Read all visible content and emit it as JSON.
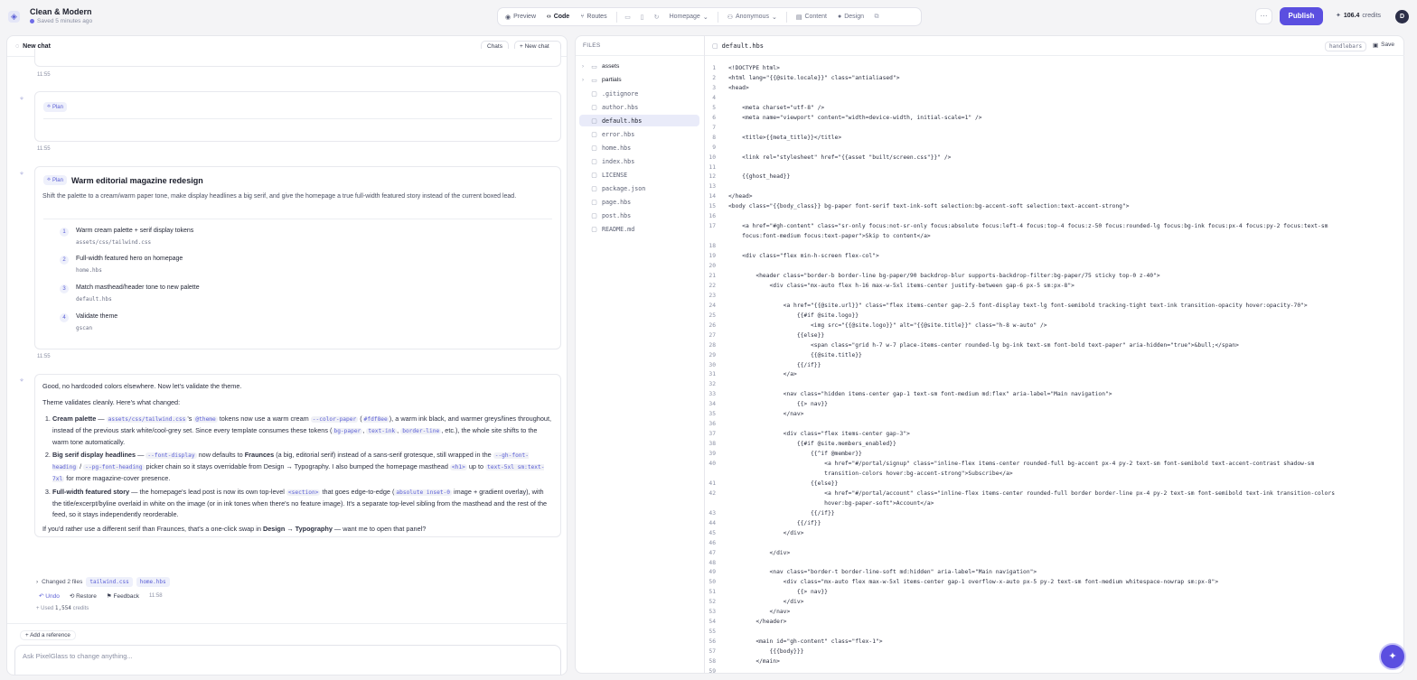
{
  "app": {
    "title": "Clean & Modern",
    "saved": "Saved 5 minutes ago"
  },
  "toolbar": {
    "modes": [
      "Preview",
      "Code",
      "Routes"
    ],
    "active_mode": "Code",
    "page_select": "Homepage",
    "role_select": "Anonymous",
    "content_label": "Content",
    "design_label": "Design",
    "publish": "Publish",
    "credits_value": "106.4",
    "credits_label": "credits",
    "avatar": "D"
  },
  "chat": {
    "title": "New chat",
    "chats_btn": "Chats",
    "new_chat_btn": "New chat",
    "times": [
      "11:55",
      "11:55",
      "11:55",
      "11:58"
    ],
    "plan_badge": "Plan",
    "plan": {
      "title": "Warm editorial magazine redesign",
      "desc": "Shift the palette to a cream/warm paper tone, make display headlines a big serif, and give the homepage a true full-width featured story instead of the current boxed lead.",
      "steps": [
        {
          "n": "1",
          "label": "Warm cream palette + serif display tokens",
          "file": "assets/css/tailwind.css"
        },
        {
          "n": "2",
          "label": "Full-width featured hero on homepage",
          "file": "home.hbs"
        },
        {
          "n": "3",
          "label": "Match masthead/header tone to new palette",
          "file": "default.hbs"
        },
        {
          "n": "4",
          "label": "Validate theme",
          "file": "gscan"
        }
      ]
    },
    "msg": {
      "p1": "Good, no hardcoded colors elsewhere. Now let's validate the theme.",
      "p2": "Theme validates cleanly. Here's what changed:",
      "i1": {
        "b": "Cream palette",
        "t1": " — ",
        "c1": "assets/css/tailwind.css",
        "t2": "'s ",
        "c2": "@theme",
        "t3": " tokens now use a warm cream ",
        "c3": "--color-paper",
        "t4": " (",
        "c4": "#fdf8ee",
        "t5": "), a warm ink black, and warmer greys/lines throughout, instead of the previous stark white/cool-grey set. Since every template consumes these tokens (",
        "c5": "bg-paper",
        "t6": ", ",
        "c6": "text-ink",
        "t7": ", ",
        "c7": "border-line",
        "t8": ", etc.), the whole site shifts to the warm tone automatically."
      },
      "i2": {
        "b": "Big serif display headlines",
        "t1": " — ",
        "c1": "--font-display",
        "t2": " now defaults to ",
        "b2": "Fraunces",
        "t3": " (a big, editorial serif) instead of a sans-serif grotesque, still wrapped in the ",
        "c2": "--gh-font-heading",
        "t4": " / ",
        "c3": "--pg-font-heading",
        "t5": " picker chain so it stays overridable from Design → Typography. I also bumped the homepage masthead ",
        "c4": "<h1>",
        "t6": " up to ",
        "c5": "text-5xl sm:text-7xl",
        "t7": " for more magazine-cover presence."
      },
      "i3": {
        "b": "Full-width featured story",
        "t1": " — the homepage's lead post is now its own top-level ",
        "c1": "<section>",
        "t2": " that goes edge-to-edge (",
        "c2": "absolute inset-0",
        "t3": " image + gradient overlay), with the title/excerpt/byline overlaid in white on the image (or in ink tones when there's no feature image). It's a separate top-level sibling from the masthead and the rest of the feed, so it stays independently reorderable."
      },
      "p3a": "If you'd rather use a different serif than Fraunces, that's a one-click swap in ",
      "p3b": "Design → Typography",
      "p3c": " — want me to open that panel?"
    },
    "changed": "Changed 2 files",
    "changed_files": [
      "tailwind.css",
      "home.hbs"
    ],
    "actions": {
      "undo": "Undo",
      "restore": "Restore",
      "feedback": "Feedback"
    },
    "used": "Used",
    "used_value": "1,554",
    "used_unit": "credits",
    "add_ref": "Add a reference",
    "composer_placeholder": "Ask PixelGlass to change anything..."
  },
  "files": {
    "header": "FILES",
    "items": [
      {
        "name": "assets",
        "type": "folder"
      },
      {
        "name": "partials",
        "type": "folder"
      },
      {
        "name": ".gitignore",
        "type": "file"
      },
      {
        "name": "author.hbs",
        "type": "file"
      },
      {
        "name": "default.hbs",
        "type": "file",
        "selected": true
      },
      {
        "name": "error.hbs",
        "type": "file"
      },
      {
        "name": "home.hbs",
        "type": "file"
      },
      {
        "name": "index.hbs",
        "type": "file"
      },
      {
        "name": "LICENSE",
        "type": "file"
      },
      {
        "name": "package.json",
        "type": "file"
      },
      {
        "name": "page.hbs",
        "type": "file"
      },
      {
        "name": "post.hbs",
        "type": "file"
      },
      {
        "name": "README.md",
        "type": "file"
      }
    ]
  },
  "editor": {
    "filename": "default.hbs",
    "lang": "handlebars",
    "save": "Save",
    "lines": [
      {
        "n": "1",
        "c": "<!DOCTYPE html>"
      },
      {
        "n": "2",
        "c": "<html lang=\"{{@site.locale}}\" class=\"antialiased\">"
      },
      {
        "n": "3",
        "c": "<head>"
      },
      {
        "n": "4",
        "c": ""
      },
      {
        "n": "5",
        "c": "    <meta charset=\"utf-8\" />"
      },
      {
        "n": "6",
        "c": "    <meta name=\"viewport\" content=\"width=device-width, initial-scale=1\" />"
      },
      {
        "n": "7",
        "c": ""
      },
      {
        "n": "8",
        "c": "    <title>{{meta_title}}</title>"
      },
      {
        "n": "9",
        "c": ""
      },
      {
        "n": "10",
        "c": "    <link rel=\"stylesheet\" href=\"{{asset \"built/screen.css\"}}\" />"
      },
      {
        "n": "11",
        "c": ""
      },
      {
        "n": "12",
        "c": "    {{ghost_head}}"
      },
      {
        "n": "13",
        "c": ""
      },
      {
        "n": "14",
        "c": "</head>"
      },
      {
        "n": "15",
        "c": "<body class=\"{{body_class}} bg-paper font-serif text-ink-soft selection:bg-accent-soft selection:text-accent-strong\">"
      },
      {
        "n": "16",
        "c": ""
      },
      {
        "n": "17",
        "c": "    <a href=\"#gh-content\" class=\"sr-only focus:not-sr-only focus:absolute focus:left-4 focus:top-4 focus:z-50 focus:rounded-lg focus:bg-ink focus:px-4 focus:py-2 focus:text-sm"
      },
      {
        "n": "",
        "c": "    focus:font-medium focus:text-paper\">Skip to content</a>"
      },
      {
        "n": "18",
        "c": ""
      },
      {
        "n": "19",
        "c": "    <div class=\"flex min-h-screen flex-col\">"
      },
      {
        "n": "20",
        "c": ""
      },
      {
        "n": "21",
        "c": "        <header class=\"border-b border-line bg-paper/90 backdrop-blur supports-backdrop-filter:bg-paper/75 sticky top-0 z-40\">"
      },
      {
        "n": "22",
        "c": "            <div class=\"mx-auto flex h-16 max-w-5xl items-center justify-between gap-6 px-5 sm:px-8\">"
      },
      {
        "n": "23",
        "c": ""
      },
      {
        "n": "24",
        "c": "                <a href=\"{{@site.url}}\" class=\"flex items-center gap-2.5 font-display text-lg font-semibold tracking-tight text-ink transition-opacity hover:opacity-70\">"
      },
      {
        "n": "25",
        "c": "                    {{#if @site.logo}}"
      },
      {
        "n": "26",
        "c": "                        <img src=\"{{@site.logo}}\" alt=\"{{@site.title}}\" class=\"h-8 w-auto\" />"
      },
      {
        "n": "27",
        "c": "                    {{else}}"
      },
      {
        "n": "28",
        "c": "                        <span class=\"grid h-7 w-7 place-items-center rounded-lg bg-ink text-sm font-bold text-paper\" aria-hidden=\"true\">&bull;</span>"
      },
      {
        "n": "29",
        "c": "                        {{@site.title}}"
      },
      {
        "n": "30",
        "c": "                    {{/if}}"
      },
      {
        "n": "31",
        "c": "                </a>"
      },
      {
        "n": "32",
        "c": ""
      },
      {
        "n": "33",
        "c": "                <nav class=\"hidden items-center gap-1 text-sm font-medium md:flex\" aria-label=\"Main navigation\">"
      },
      {
        "n": "34",
        "c": "                    {{> nav}}"
      },
      {
        "n": "35",
        "c": "                </nav>"
      },
      {
        "n": "36",
        "c": ""
      },
      {
        "n": "37",
        "c": "                <div class=\"flex items-center gap-3\">"
      },
      {
        "n": "38",
        "c": "                    {{#if @site.members_enabled}}"
      },
      {
        "n": "39",
        "c": "                        {{^if @member}}"
      },
      {
        "n": "40",
        "c": "                            <a href=\"#/portal/signup\" class=\"inline-flex items-center rounded-full bg-accent px-4 py-2 text-sm font-semibold text-accent-contrast shadow-sm"
      },
      {
        "n": "",
        "c": "                            transition-colors hover:bg-accent-strong\">Subscribe</a>"
      },
      {
        "n": "41",
        "c": "                        {{else}}"
      },
      {
        "n": "42",
        "c": "                            <a href=\"#/portal/account\" class=\"inline-flex items-center rounded-full border border-line px-4 py-2 text-sm font-semibold text-ink transition-colors"
      },
      {
        "n": "",
        "c": "                            hover:bg-paper-soft\">Account</a>"
      },
      {
        "n": "43",
        "c": "                        {{/if}}"
      },
      {
        "n": "44",
        "c": "                    {{/if}}"
      },
      {
        "n": "45",
        "c": "                </div>"
      },
      {
        "n": "46",
        "c": ""
      },
      {
        "n": "47",
        "c": "            </div>"
      },
      {
        "n": "48",
        "c": ""
      },
      {
        "n": "49",
        "c": "            <nav class=\"border-t border-line-soft md:hidden\" aria-label=\"Main navigation\">"
      },
      {
        "n": "50",
        "c": "                <div class=\"mx-auto flex max-w-5xl items-center gap-1 overflow-x-auto px-5 py-2 text-sm font-medium whitespace-nowrap sm:px-8\">"
      },
      {
        "n": "51",
        "c": "                    {{> nav}}"
      },
      {
        "n": "52",
        "c": "                </div>"
      },
      {
        "n": "53",
        "c": "            </nav>"
      },
      {
        "n": "54",
        "c": "        </header>"
      },
      {
        "n": "55",
        "c": ""
      },
      {
        "n": "56",
        "c": "        <main id=\"gh-content\" class=\"flex-1\">"
      },
      {
        "n": "57",
        "c": "            {{{body}}}"
      },
      {
        "n": "58",
        "c": "        </main>"
      },
      {
        "n": "59",
        "c": ""
      }
    ]
  }
}
